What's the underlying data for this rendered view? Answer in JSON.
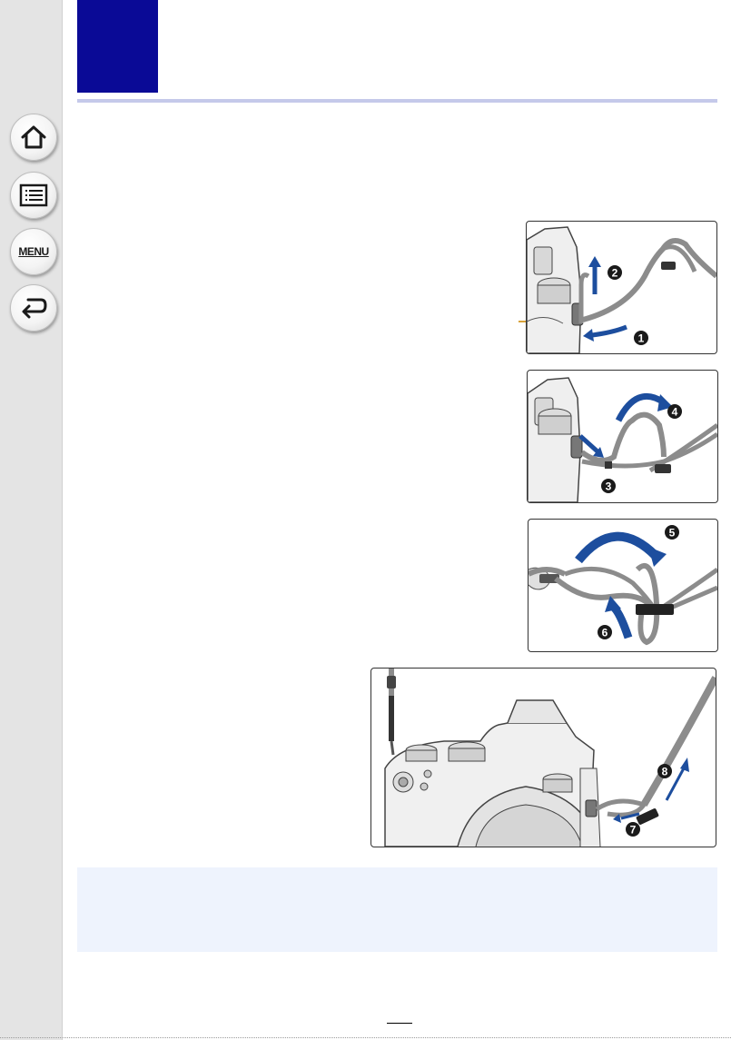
{
  "sidebar": {
    "buttons": [
      {
        "id": "home",
        "icon": "home-icon"
      },
      {
        "id": "contents",
        "icon": "list-icon"
      },
      {
        "id": "menu",
        "icon": "menu-icon",
        "label": "MENU"
      },
      {
        "id": "back",
        "icon": "back-arrow-icon"
      }
    ]
  },
  "colors": {
    "chapter_block": "#0a0a96",
    "title_rule": "#c5c9ea",
    "step_arrow": "#1d4e9e",
    "strap": "#8c8c8c",
    "callout_line": "#d9a23a",
    "note_background": "#eef3fd",
    "sidebar": "#e4e4e4"
  },
  "figures": [
    {
      "name": "figure-step-1-2",
      "steps": [
        "1",
        "2"
      ]
    },
    {
      "name": "figure-step-3-4",
      "steps": [
        "3",
        "4"
      ]
    },
    {
      "name": "figure-step-5-6",
      "steps": [
        "5",
        "6"
      ]
    },
    {
      "name": "figure-step-7-8",
      "steps": [
        "7",
        "8"
      ]
    }
  ],
  "page": {
    "number": "",
    "note_text": ""
  }
}
